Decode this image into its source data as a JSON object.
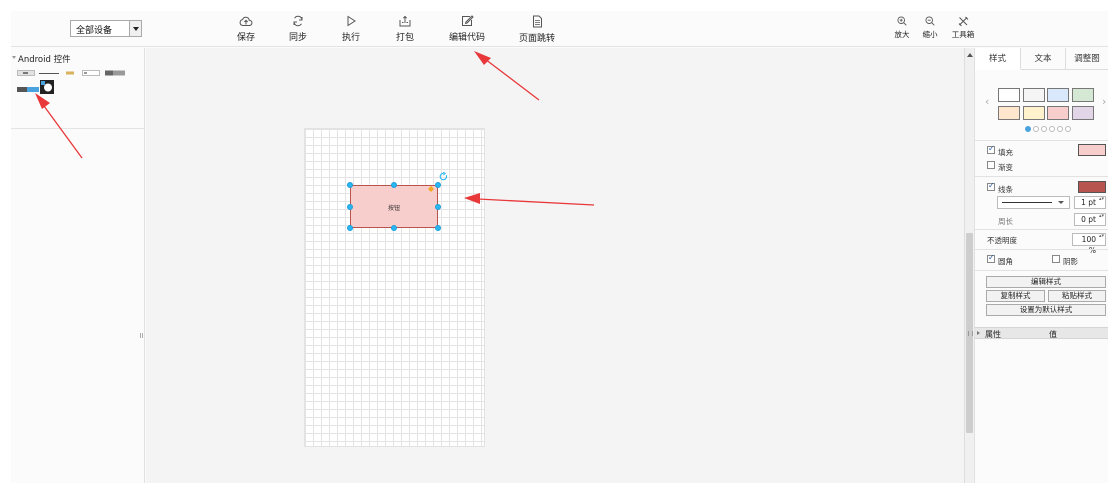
{
  "toolbar": {
    "device_select": "全部设备",
    "save": "保存",
    "sync": "同步",
    "run": "执行",
    "package": "打包",
    "edit_code": "编辑代码",
    "page_jump": "页面跳转",
    "zoom_in": "放大",
    "zoom_out": "缩小",
    "toolbar_toggle": "工具箱"
  },
  "library": {
    "title": "Android 控件"
  },
  "canvas": {
    "shape_label": "按钮",
    "shape_fill": "#f8cecc",
    "shape_stroke": "#b85450"
  },
  "format_panel": {
    "tabs": [
      "样式",
      "文本",
      "调整图"
    ],
    "swatches": [
      "#ffffff",
      "#f5f5f5",
      "#dae8fc",
      "#d5e8d4",
      "#ffe6cc",
      "#fff2cc",
      "#f8cecc",
      "#e1d5e7"
    ],
    "fill_label": "填充",
    "fill_color": "#f8cecc",
    "gradient_label": "渐变",
    "line_label": "线条",
    "line_color": "#b85450",
    "line_width": "1 pt",
    "perimeter_label": "周长",
    "perimeter_value": "0 pt",
    "opacity_label": "不透明度",
    "opacity_value": "100 %",
    "rounded_label": "圆角",
    "shadow_label": "阴影",
    "edit_style": "编辑样式",
    "copy_style": "复制样式",
    "paste_style": "粘贴样式",
    "set_default": "设置为默认样式",
    "prop_col": "属性",
    "value_col": "值"
  },
  "colors": {
    "accent": "#29b6f2",
    "annotation": "#e8383a"
  }
}
